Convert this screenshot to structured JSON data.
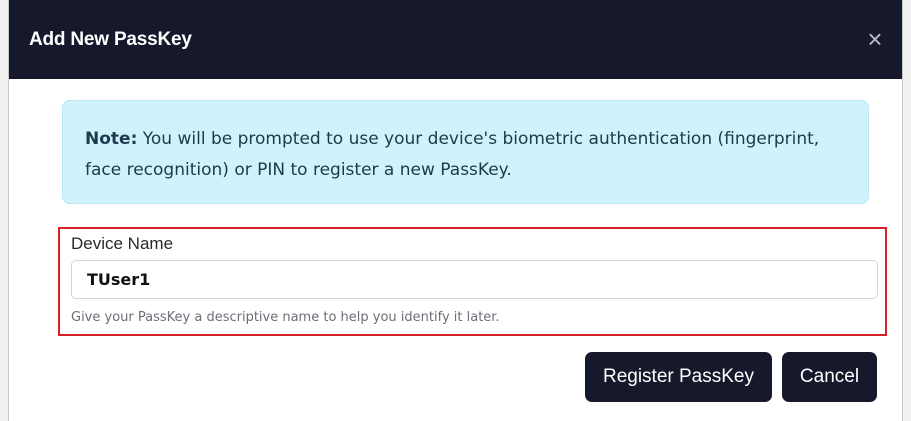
{
  "dialog": {
    "title": "Add New PassKey",
    "close_icon": "close-icon",
    "close_glyph": "×"
  },
  "note": {
    "label": "Note:",
    "text": " You will be prompted to use your device's biometric authentication (fingerprint, face recognition) or PIN to register a new PassKey."
  },
  "form": {
    "device_name_label": "Device Name",
    "device_name_value": "TUser1",
    "device_name_help": "Give your PassKey a descriptive name to help you identify it later."
  },
  "buttons": {
    "register_label": "Register PassKey",
    "cancel_label": "Cancel"
  },
  "colors": {
    "header_bg": "#15192b",
    "note_bg": "#cff2fc",
    "highlight_border": "#d61f26",
    "button_bg": "#15192b"
  }
}
